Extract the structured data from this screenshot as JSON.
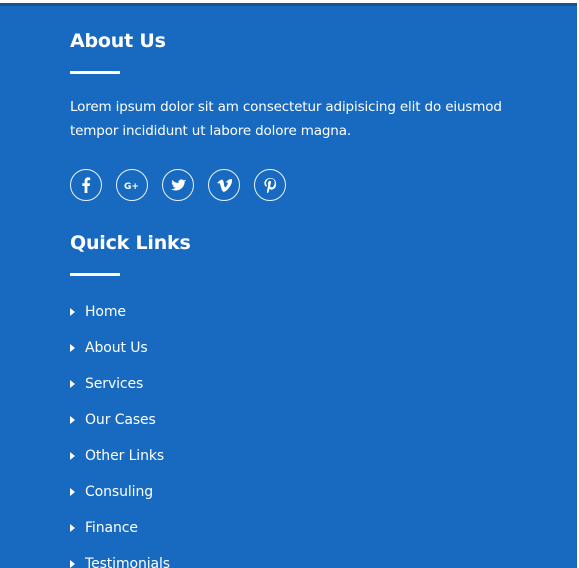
{
  "footer": {
    "about": {
      "title": "About Us",
      "text": "Lorem ipsum dolor sit am consectetur adipisicing elit do eiusmod tempor incididunt ut labore dolore magna."
    },
    "social": [
      {
        "name": "facebook-icon",
        "label": "f"
      },
      {
        "name": "google-plus-icon",
        "label": "G+"
      },
      {
        "name": "twitter-icon",
        "label": ""
      },
      {
        "name": "vimeo-icon",
        "label": "v"
      },
      {
        "name": "pinterest-icon",
        "label": "p"
      }
    ],
    "quick_links": {
      "title": "Quick Links",
      "items": [
        "Home",
        "About Us",
        "Services",
        "Our Cases",
        "Other Links",
        "Consuling",
        "Finance",
        "Testimonials"
      ]
    },
    "colors": {
      "background": "#176abf",
      "text": "#ffffff",
      "top_shadow": "#1b5391"
    }
  }
}
